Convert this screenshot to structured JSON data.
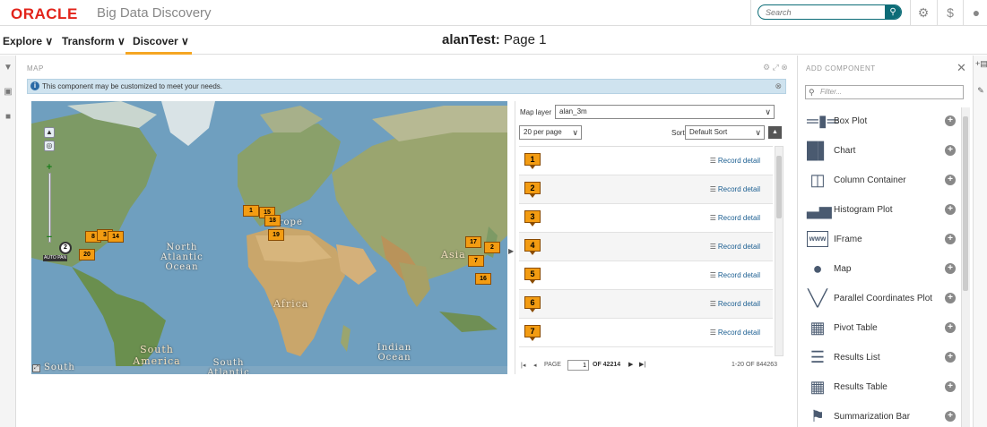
{
  "header": {
    "logo": "ORACLE",
    "app_title": "Big Data Discovery",
    "search_placeholder": "Search",
    "icons": [
      "search-icon",
      "gear-icon",
      "help-icon",
      "user-icon"
    ]
  },
  "nav": {
    "items": [
      "Explore",
      "Transform",
      "Discover"
    ],
    "active": "Discover",
    "project": "alanTest:",
    "page": "Page 1"
  },
  "map_component": {
    "title": "MAP",
    "info_message": "This component may be customized to meet your needs.",
    "auto_pan": "AUTO PAN",
    "labels": {
      "europe": "Europe",
      "north_atlantic": "North Atlantic Ocean",
      "asia": "Asia",
      "africa": "Africa",
      "south_america": "South America",
      "indian_ocean": "Indian Ocean",
      "south_atlantic": "South Atlantic",
      "south": "South"
    },
    "markers": [
      "1",
      "15",
      "18",
      "19",
      "8",
      "3",
      "14",
      "2",
      "20",
      "17",
      "2",
      "7",
      "16"
    ]
  },
  "results": {
    "map_layer_label": "Map layer",
    "map_layer_value": "alan_3m",
    "per_page": "20 per page",
    "sort_label": "Sort",
    "sort_value": "Default Sort",
    "record_detail_label": "Record detail",
    "rows": [
      "1",
      "2",
      "3",
      "4",
      "5",
      "6",
      "7"
    ],
    "pager": {
      "page_label": "PAGE",
      "page_value": "1",
      "of_label": "OF 42214",
      "range": "1-20 OF 844263"
    }
  },
  "add_component": {
    "title": "ADD COMPONENT",
    "filter_placeholder": "Filter...",
    "items": [
      {
        "label": "Box Plot",
        "icon": "box-plot-icon"
      },
      {
        "label": "Chart",
        "icon": "chart-icon"
      },
      {
        "label": "Column Container",
        "icon": "column-container-icon"
      },
      {
        "label": "Histogram Plot",
        "icon": "histogram-icon"
      },
      {
        "label": "IFrame",
        "icon": "iframe-icon"
      },
      {
        "label": "Map",
        "icon": "map-icon"
      },
      {
        "label": "Parallel Coordinates Plot",
        "icon": "parallel-coordinates-icon"
      },
      {
        "label": "Pivot Table",
        "icon": "pivot-table-icon"
      },
      {
        "label": "Results List",
        "icon": "results-list-icon"
      },
      {
        "label": "Results Table",
        "icon": "results-table-icon"
      },
      {
        "label": "Summarization Bar",
        "icon": "summarization-bar-icon"
      }
    ]
  },
  "colors": {
    "accent": "#f5a623",
    "brand_red": "#e2231a",
    "teal": "#0c6c77",
    "marker": "#f39c12"
  }
}
